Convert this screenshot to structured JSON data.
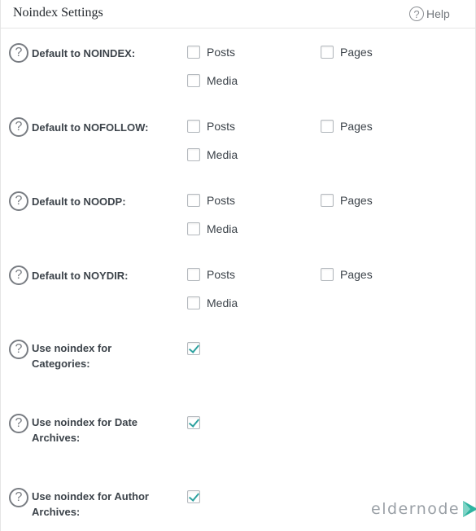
{
  "panel": {
    "title": "Noindex Settings",
    "help_label": "Help",
    "help_icon": "question-circle-icon"
  },
  "rows": [
    {
      "label": "Default to NOINDEX:",
      "options": [
        {
          "label": "Posts",
          "checked": false
        },
        {
          "label": "Pages",
          "checked": false
        },
        {
          "label": "Media",
          "checked": false
        }
      ]
    },
    {
      "label": "Default to NOFOLLOW:",
      "options": [
        {
          "label": "Posts",
          "checked": false
        },
        {
          "label": "Pages",
          "checked": false
        },
        {
          "label": "Media",
          "checked": false
        }
      ]
    },
    {
      "label": "Default to NOODP:",
      "options": [
        {
          "label": "Posts",
          "checked": false
        },
        {
          "label": "Pages",
          "checked": false
        },
        {
          "label": "Media",
          "checked": false
        }
      ]
    },
    {
      "label": "Default to NOYDIR:",
      "options": [
        {
          "label": "Posts",
          "checked": false
        },
        {
          "label": "Pages",
          "checked": false
        },
        {
          "label": "Media",
          "checked": false
        }
      ]
    },
    {
      "label_line1": "Use noindex for",
      "label_line2": "Categories:",
      "checked": true
    },
    {
      "label_line1": "Use noindex for Date",
      "label_line2": "Archives:",
      "checked": true
    },
    {
      "label_line1": "Use noindex for Author",
      "label_line2": "Archives:",
      "checked": true
    }
  ],
  "watermark": {
    "text": "eldernode",
    "color": "#9aa0a6",
    "accent": "#2fb3a0"
  },
  "colors": {
    "checkmark": "#2ea2a0",
    "border": "#e5e5e5"
  }
}
